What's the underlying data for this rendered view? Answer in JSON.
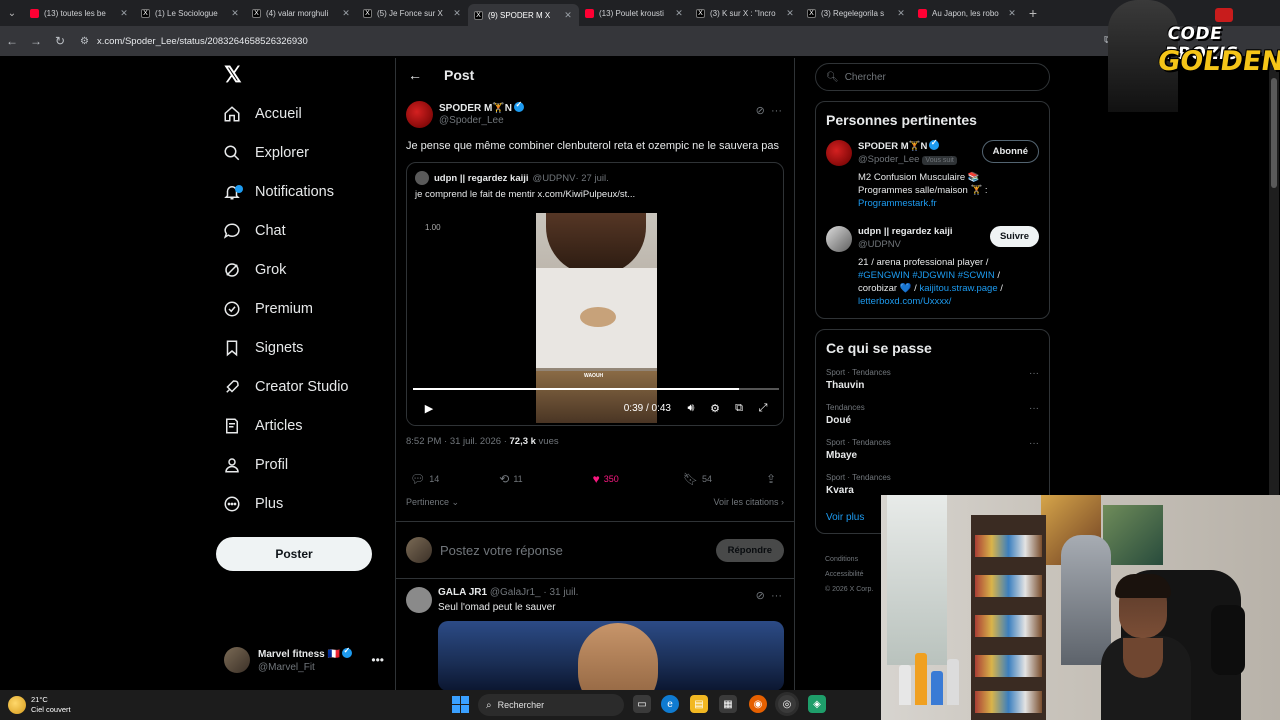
{
  "browser": {
    "tabs": [
      {
        "title": "(13) toutes les be",
        "icon": "youtube-icon",
        "active": false
      },
      {
        "title": "(1) Le Sociologue",
        "icon": "x-icon",
        "active": false
      },
      {
        "title": "(4) valar morghuli",
        "icon": "x-icon",
        "active": false
      },
      {
        "title": "(5) Je Fonce sur X",
        "icon": "x-icon",
        "active": false
      },
      {
        "title": "(9) SPODER M X",
        "icon": "x-icon",
        "active": true
      },
      {
        "title": "(13) Poulet krousti",
        "icon": "youtube-icon",
        "active": false
      },
      {
        "title": "(3) K sur X : \"Incro",
        "icon": "x-icon",
        "active": false
      },
      {
        "title": "(3) Regelegorila s",
        "icon": "x-icon",
        "active": false
      },
      {
        "title": "Au Japon, les robo",
        "icon": "youtube-icon",
        "active": false
      }
    ],
    "url": "x.com/Spoder_Lee/status/2083264658526326930"
  },
  "nav": {
    "items": [
      {
        "label": "Accueil",
        "icon": "home-icon"
      },
      {
        "label": "Explorer",
        "icon": "search-icon"
      },
      {
        "label": "Notifications",
        "icon": "bell-icon"
      },
      {
        "label": "Chat",
        "icon": "chat-icon"
      },
      {
        "label": "Grok",
        "icon": "grok-icon"
      },
      {
        "label": "Premium",
        "icon": "premium-icon"
      },
      {
        "label": "Signets",
        "icon": "bookmark-icon"
      },
      {
        "label": "Creator Studio",
        "icon": "rocket-icon"
      },
      {
        "label": "Articles",
        "icon": "article-icon"
      },
      {
        "label": "Profil",
        "icon": "person-icon"
      },
      {
        "label": "Plus",
        "icon": "more-circle-icon"
      }
    ],
    "post_button": "Poster",
    "account": {
      "name": "Marvel fitness 🇫🇷",
      "handle": "@Marvel_Fit"
    }
  },
  "post": {
    "header": "Post",
    "author": {
      "name": "SPODER M🏋N",
      "handle": "@Spoder_Lee"
    },
    "text": "Je pense que même combiner clenbuterol reta et ozempic ne le sauvera pas",
    "quote": {
      "author": "udpn || regardez kaiji",
      "handle": "@UDPNV",
      "date": "· 27 juil.",
      "text": "je comprend le fait de mentir  x.com/KiwiPulpeux/st..."
    },
    "video": {
      "speed": "1.00",
      "time": "0:39 / 0:43",
      "progress": 0.89,
      "caption": "WAOUH"
    },
    "meta_time": "8:52 PM · 31 juil. 2026 · ",
    "views_count": "72,3 k",
    "views_label": " vues",
    "stats": {
      "replies": "14",
      "reposts": "11",
      "likes": "350",
      "bookmarks": "54"
    },
    "sort_label": "Pertinence",
    "quotes_link": "Voir les citations",
    "reply_placeholder": "Postez votre réponse",
    "reply_button": "Répondre"
  },
  "reply": {
    "name": "GALA JR1",
    "meta": "@GalaJr1_ · 31 juil.",
    "text": "Seul l'omad peut le sauver"
  },
  "sidebar": {
    "search_placeholder": "Chercher",
    "relevant": {
      "title": "Personnes pertinentes",
      "people": [
        {
          "name": "SPODER M🏋N",
          "handle": "@Spoder_Lee",
          "follows_you": "Vous suit",
          "button": "Abonné",
          "bio_line1": "M2 Confusion Musculaire 📚",
          "bio_line2": "Programmes salle/maison 🏋 :",
          "bio_link": "Programmestark.fr"
        },
        {
          "name": "udpn || regardez kaiji",
          "handle": "@UDPNV",
          "button": "Suivre",
          "bio_line1": "21 / arena professional player /",
          "bio_tags": "#GENGWIN #JDGWIN #SCWIN",
          "bio_mid": "corobizar 💙 / ",
          "bio_link1": "kaijitou.straw.page",
          "bio_sep": " /",
          "bio_link2": "letterboxd.com/Uxxxx/"
        }
      ]
    },
    "trends": {
      "title": "Ce qui se passe",
      "items": [
        {
          "category": "Sport · Tendances",
          "name": "Thauvin"
        },
        {
          "category": "Tendances",
          "name": "Doué"
        },
        {
          "category": "Sport · Tendances",
          "name": "Mbaye"
        },
        {
          "category": "Sport · Tendances",
          "name": "Kvara"
        }
      ],
      "see_more": "Voir plus"
    },
    "footer": [
      "Conditions",
      "Accessibilité",
      "© 2026 X Corp."
    ]
  },
  "overlay": {
    "line1": "CODE PROZIS",
    "line2": "GOLDENG"
  },
  "taskbar": {
    "temp": "21°C",
    "weather": "Ciel couvert",
    "search": "Rechercher"
  },
  "colors": {
    "accent": "#1d9bf0",
    "like": "#f91880",
    "background": "#000000"
  }
}
